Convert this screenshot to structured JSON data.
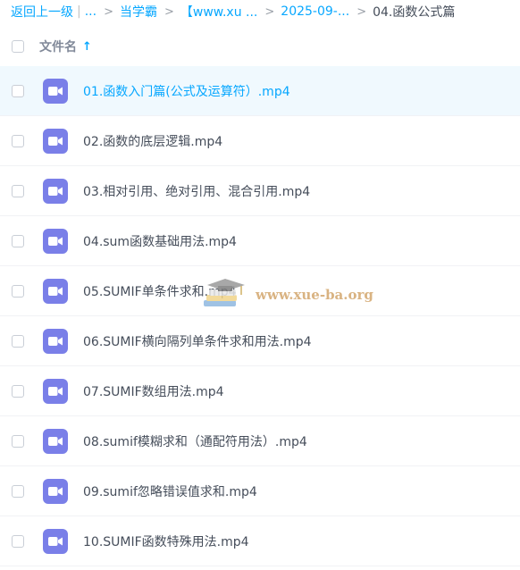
{
  "breadcrumb": {
    "back": "返回上一级",
    "bar": "|",
    "ellipsis": "...",
    "sep": ">",
    "items": [
      "当学霸",
      "【www.xu ...",
      "2025-09-..."
    ],
    "current": "04.函数公式篇"
  },
  "header": {
    "column_label": "文件名",
    "sort_glyph": "↑"
  },
  "files": [
    {
      "name": "01.函数入门篇(公式及运算符）.mp4",
      "selected": true
    },
    {
      "name": "02.函数的底层逻辑.mp4"
    },
    {
      "name": "03.相对引用、绝对引用、混合引用.mp4"
    },
    {
      "name": "04.sum函数基础用法.mp4"
    },
    {
      "name": "05.SUMIF单条件求和.mp4"
    },
    {
      "name": "06.SUMIF横向隔列单条件求和用法.mp4"
    },
    {
      "name": "07.SUMIF数组用法.mp4"
    },
    {
      "name": "08.sumif模糊求和（通配符用法）.mp4"
    },
    {
      "name": "09.sumif忽略错误值求和.mp4"
    },
    {
      "name": "10.SUMIF函数特殊用法.mp4"
    }
  ],
  "watermark": {
    "text": "www.xue-ba.org"
  },
  "icons": {
    "file": "video-file-icon",
    "sort": "sort-ascending-icon",
    "watermark": "graduation-cap-books-icon"
  },
  "colors": {
    "accent": "#06a7ff",
    "video_icon": "#7a7fe8",
    "selected_row": "#f0f9fe",
    "watermark": "#d3a66d"
  }
}
